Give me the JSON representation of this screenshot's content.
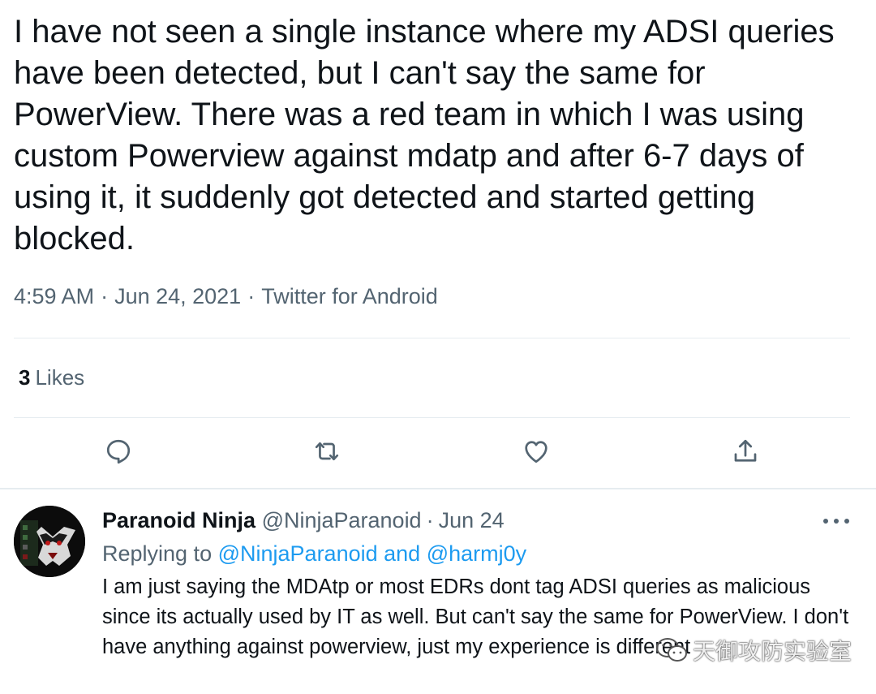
{
  "tweet": {
    "text": "I have not seen a single instance where my ADSI queries have been detected, but I can't say the same for PowerView. There was a red team in which I was using custom Powerview against mdatp and after 6-7 days of using it, it suddenly got detected and started getting blocked.",
    "time": "4:59 AM",
    "date": "Jun 24, 2021",
    "source": "Twitter for Android",
    "separator": "·",
    "likes_count": "3",
    "likes_label": "Likes"
  },
  "actions": {
    "reply_icon": "speech-bubble-icon",
    "retweet_icon": "retweet-arrows-icon",
    "like_icon": "heart-outline-icon",
    "share_icon": "share-upload-icon",
    "icon_color": "#536471"
  },
  "reply": {
    "display_name": "Paranoid Ninja",
    "handle": "@NinjaParanoid",
    "separator": "·",
    "date": "Jun 24",
    "replying_prefix": "Replying to",
    "replying_user1": "@NinjaParanoid",
    "replying_and": "and",
    "replying_user2": "@harmj0y",
    "text": "I am just saying the MDAtp or most EDRs dont tag ADSI queries as malicious since its actually used by IT as well. But can't say the same for PowerView. I don't have anything against powerview, just my experience is different"
  },
  "watermark": {
    "text": "天御攻防实验室"
  },
  "colors": {
    "text_primary": "#0f1419",
    "text_secondary": "#536471",
    "link": "#1d9bf0",
    "divider": "#e6ecf0"
  }
}
